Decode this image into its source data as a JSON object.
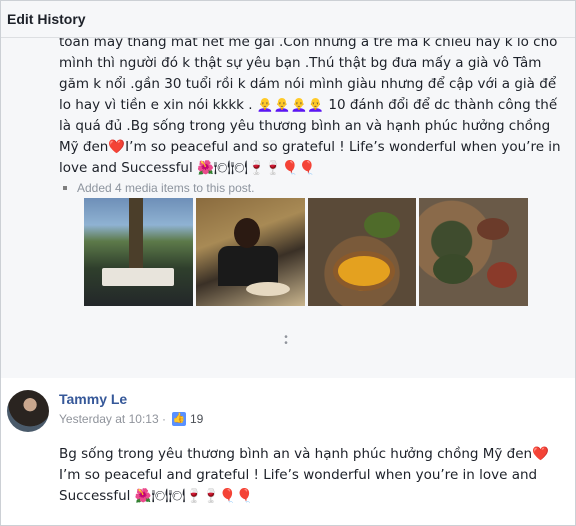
{
  "header": {
    "title": "Edit History"
  },
  "old_entry": {
    "text": "toàn mấy tháng mất hết me gái .Con những a trẻ mà k chiều hay k lo cho mình thì người đó k thật sự yêu bạn .Thú thật bg đưa mấy a già vô Tâm găm k nổi .gần 30 tuổi rồi k dám nói mình giàu nhưng để cập với a già để lo hay vì tiền e xin nói kkkk . 👩‍🦲👩‍🦲👩‍🦲👩‍🦲 10 đánh đổi để dc thành công thế là quá đủ .Bg sống trong yêu thương bình an và hạnh phúc hưởng chồng Mỹ đen❤️I’m so peaceful and so grateful ! Life’s wonderful when you’re in love and Successful 🌺🍽🍽🍷🍷🎈🎈",
    "media_note": "Added 4 media items to this post."
  },
  "new_entry": {
    "author": "Tammy Le",
    "timestamp": "Yesterday at 10:13 ·",
    "like_icon": "thumbs-up-icon",
    "like_count": "19",
    "text": "Bg sống trong yêu thương bình an và hạnh phúc hưởng chồng Mỹ đen❤️I’m so peaceful and grateful ! Life’s wonderful when you’re in love and Successful 🌺🍽🍽🍷🍷🎈🎈"
  },
  "colors": {
    "link": "#365899",
    "meta": "#90949c",
    "header_bg": "#f6f7f9"
  }
}
